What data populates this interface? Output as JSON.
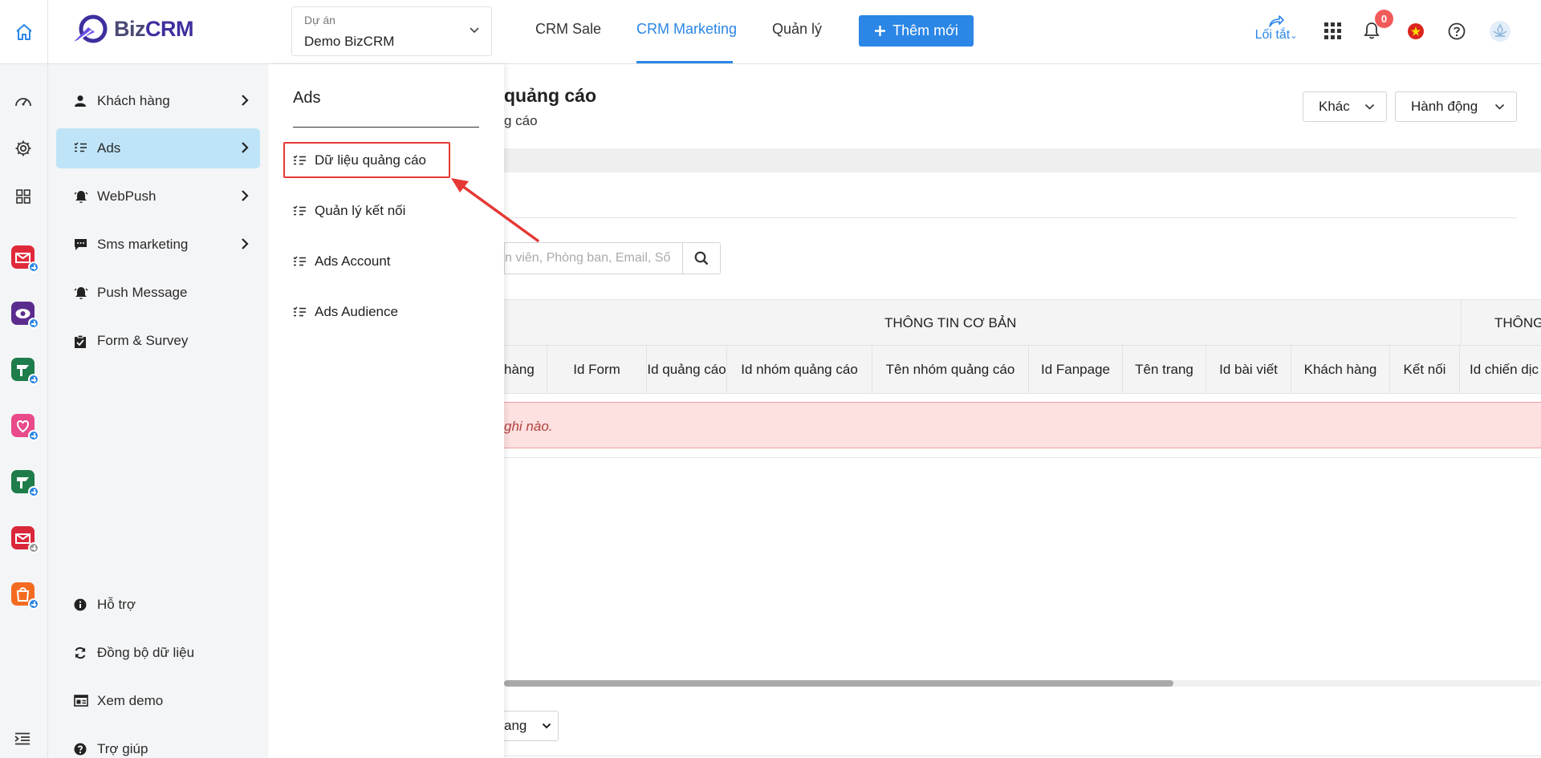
{
  "header": {
    "brand": {
      "prefix": "Biz",
      "suffix": "CRM"
    },
    "project": {
      "label": "Dự án",
      "value": "Demo BizCRM"
    },
    "tabs": [
      {
        "label": "CRM Sale"
      },
      {
        "label": "CRM Marketing",
        "active": true
      },
      {
        "label": "Quản lý"
      }
    ],
    "add_new_label": "Thêm mới",
    "shortcut_label": "Lối tắt",
    "notification_count": "0",
    "accent_color": "#2b86e6"
  },
  "rail": {
    "icons": [
      "dashboard-icon",
      "settings-icon",
      "grid-icon"
    ],
    "apps": [
      "mail-app",
      "chat-bot-app",
      "flag-app",
      "love-app",
      "flag-app-2",
      "mail-app-2",
      "bag-app"
    ],
    "collapse_icon": "collapse-menu-icon"
  },
  "sidebar": {
    "items": [
      {
        "label": "Khách hàng",
        "icon": "person-icon",
        "has_submenu": true
      },
      {
        "label": "Ads",
        "icon": "list-icon",
        "has_submenu": true,
        "active": true
      },
      {
        "label": "WebPush",
        "icon": "bell-icon",
        "has_submenu": true
      },
      {
        "label": "Sms marketing",
        "icon": "message-icon",
        "has_submenu": true
      },
      {
        "label": "Push Message",
        "icon": "bell-icon",
        "has_submenu": false
      },
      {
        "label": "Form & Survey",
        "icon": "clipboard-icon",
        "has_submenu": false
      }
    ],
    "footer_items": [
      {
        "label": "Hỗ trợ",
        "icon": "info-icon"
      },
      {
        "label": "Đồng bộ dữ liệu",
        "icon": "sync-icon"
      },
      {
        "label": "Xem demo",
        "icon": "demo-icon"
      },
      {
        "label": "Trợ giúp",
        "icon": "help-icon"
      }
    ]
  },
  "flyout": {
    "title": "Ads",
    "items": [
      {
        "label": "Dữ liệu quảng cáo",
        "highlighted": true
      },
      {
        "label": "Quản lý kết nối"
      },
      {
        "label": "Ads Account"
      },
      {
        "label": "Ads Audience"
      }
    ],
    "highlight_color": "#e53935"
  },
  "main": {
    "title": "quảng cáo",
    "subtitle": "g cáo",
    "actions": {
      "other": "Khác",
      "action": "Hành động"
    },
    "search_placeholder": "n viên, Phòng ban, Email, Số",
    "table": {
      "group_headers": [
        "THÔNG TIN CƠ BẢN",
        "THÔNG"
      ],
      "columns": [
        "hàng",
        "Id Form",
        "Id quảng cáo",
        "Id nhóm quảng cáo",
        "Tên nhóm quảng cáo",
        "Id Fanpage",
        "Tên trang",
        "Id bài viết",
        "Khách hàng",
        "Kết nối",
        "Id chiến dịc"
      ],
      "empty_text": "ghi nào."
    },
    "page_size_label": "ang"
  }
}
